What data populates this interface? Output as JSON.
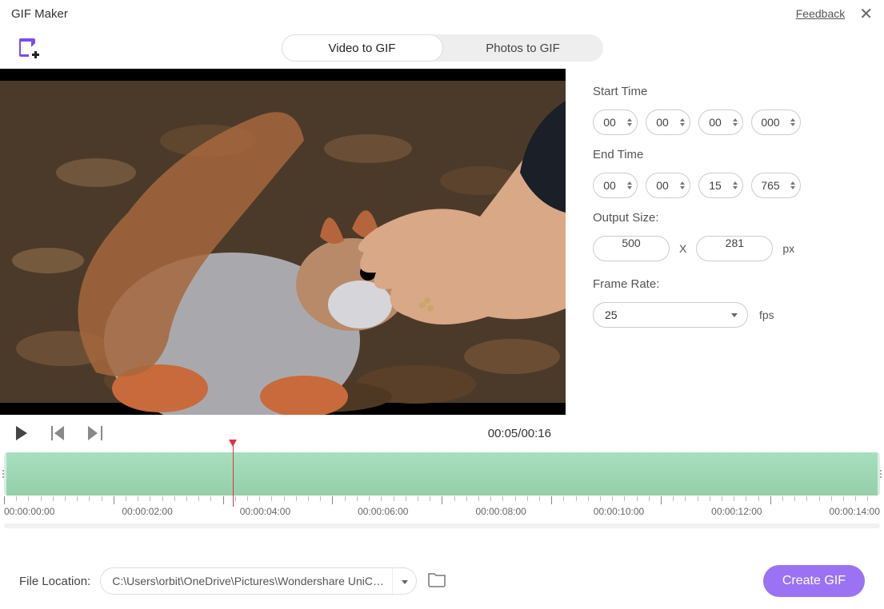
{
  "title": "GIF Maker",
  "feedback": "Feedback",
  "tabs": {
    "video": "Video to GIF",
    "photos": "Photos to GIF"
  },
  "player": {
    "current": "00:05",
    "total": "00:16"
  },
  "settings": {
    "start_label": "Start Time",
    "start": {
      "h": "00",
      "m": "00",
      "s": "00",
      "ms": "000"
    },
    "end_label": "End Time",
    "end": {
      "h": "00",
      "m": "00",
      "s": "15",
      "ms": "765"
    },
    "output_label": "Output Size:",
    "width": "500",
    "height": "281",
    "px": "px",
    "x": "X",
    "framerate_label": "Frame Rate:",
    "framerate": "25",
    "fps": "fps"
  },
  "timeline": {
    "codes": [
      "00:00:00:00",
      "00:00:02:00",
      "00:00:04:00",
      "00:00:06:00",
      "00:00:08:00",
      "00:00:10:00",
      "00:00:12:00",
      "00:00:14:00"
    ]
  },
  "footer": {
    "file_label": "File Location:",
    "path": "C:\\Users\\orbit\\OneDrive\\Pictures\\Wondershare UniConvert",
    "create": "Create GIF"
  }
}
